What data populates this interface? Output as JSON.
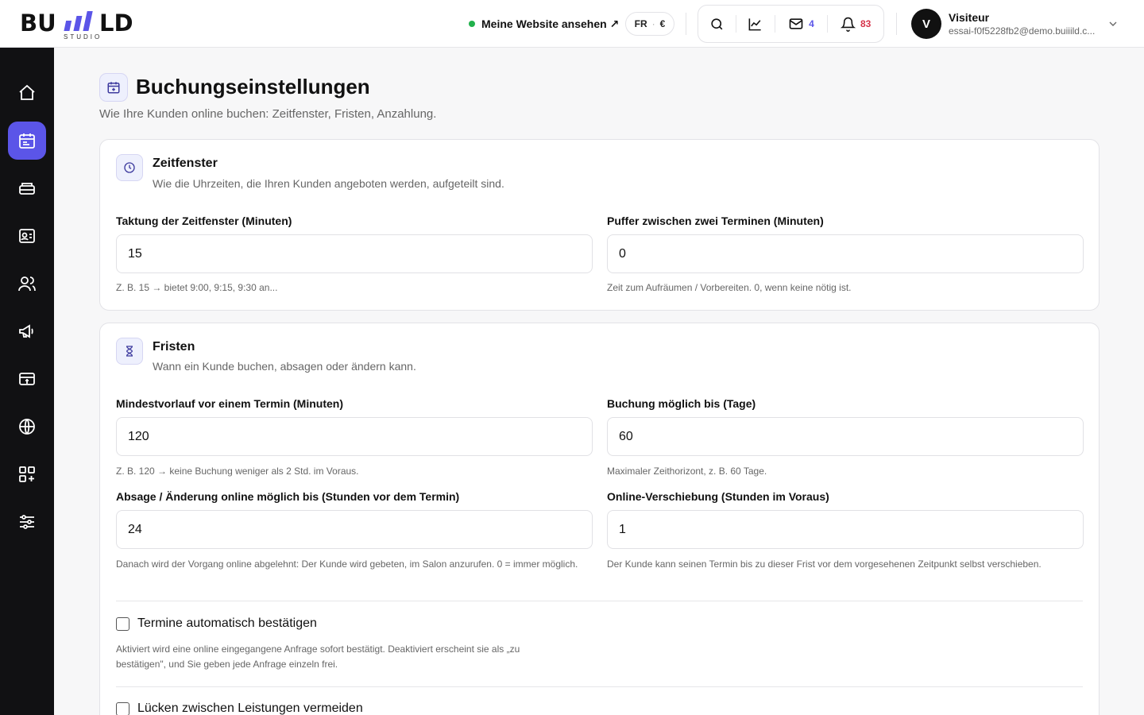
{
  "header": {
    "logo": "BUIIILD",
    "logo_sub": "STUDIO",
    "site_link": "Meine Website ansehen ↗",
    "lang": "FR",
    "currency": "€",
    "mail_count": "4",
    "notif_count": "83",
    "user_initial": "V",
    "user_name": "Visiteur",
    "user_email": "essai-f0f5228fb2@demo.buiiild.c..."
  },
  "sidebar": {
    "items": [
      {
        "icon": "home-icon"
      },
      {
        "icon": "calendar-icon",
        "active": true
      },
      {
        "icon": "services-icon"
      },
      {
        "icon": "contact-card-icon"
      },
      {
        "icon": "users-icon"
      },
      {
        "icon": "megaphone-icon"
      },
      {
        "icon": "payment-icon"
      },
      {
        "icon": "globe-icon"
      },
      {
        "icon": "apps-icon"
      },
      {
        "icon": "sliders-icon"
      }
    ]
  },
  "page": {
    "title": "Buchungseinstellungen",
    "subtitle": "Wie Ihre Kunden online buchen: Zeitfenster, Fristen, Anzahlung."
  },
  "zeitfenster": {
    "title": "Zeitfenster",
    "subtitle": "Wie die Uhrzeiten, die Ihren Kunden angeboten werden, aufgeteilt sind.",
    "taktung_label": "Taktung der Zeitfenster (Minuten)",
    "taktung_value": "15",
    "taktung_help": "Z. B. 15 → bietet 9:00, 9:15, 9:30 an...",
    "puffer_label": "Puffer zwischen zwei Terminen (Minuten)",
    "puffer_value": "0",
    "puffer_help": "Zeit zum Aufräumen / Vorbereiten. 0, wenn keine nötig ist."
  },
  "fristen": {
    "title": "Fristen",
    "subtitle": "Wann ein Kunde buchen, absagen oder ändern kann.",
    "vorlauf_label": "Mindestvorlauf vor einem Termin (Minuten)",
    "vorlauf_value": "120",
    "vorlauf_help": "Z. B. 120 → keine Buchung weniger als 2 Std. im Voraus.",
    "buchung_label": "Buchung möglich bis (Tage)",
    "buchung_value": "60",
    "buchung_help": "Maximaler Zeithorizont, z. B. 60 Tage.",
    "absage_label": "Absage / Änderung online möglich bis (Stunden vor dem Termin)",
    "absage_value": "24",
    "absage_help": "Danach wird der Vorgang online abgelehnt: Der Kunde wird gebeten, im Salon anzurufen. 0 = immer möglich.",
    "verschiebung_label": "Online-Verschiebung (Stunden im Voraus)",
    "verschiebung_value": "1",
    "verschiebung_help": "Der Kunde kann seinen Termin bis zu dieser Frist vor dem vorgesehenen Zeitpunkt selbst verschieben.",
    "auto_confirm_label": "Termine automatisch bestätigen",
    "auto_confirm_help": "Aktiviert wird eine online eingegangene Anfrage sofort bestätigt. Deaktiviert erscheint sie als „zu bestätigen\", und Sie geben jede Anfrage einzeln frei.",
    "gaps_label": "Lücken zwischen Leistungen vermeiden"
  }
}
